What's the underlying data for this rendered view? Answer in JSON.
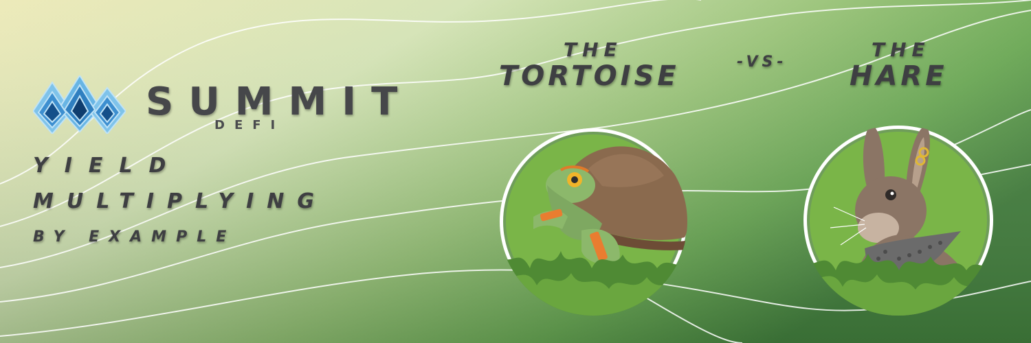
{
  "brand": {
    "name": "SUMMIT",
    "subtitle": "DEFI",
    "logo_icon": "mountain-peaks-icon"
  },
  "tagline": {
    "line1": "YIELD",
    "line2": "MULTIPLYING",
    "line3": "BY EXAMPLE"
  },
  "matchup": {
    "left_prefix": "THE",
    "left_name": "TORTOISE",
    "versus": "-VS-",
    "right_prefix": "THE",
    "right_name": "HARE",
    "left_icon": "tortoise-icon",
    "right_icon": "hare-icon"
  },
  "colors": {
    "text": "#3e3f42",
    "bg_light": "#ece9b6",
    "bg_dark": "#3f7d38",
    "grass": "#7ab548",
    "logo_blue": "#2f7fc0"
  }
}
